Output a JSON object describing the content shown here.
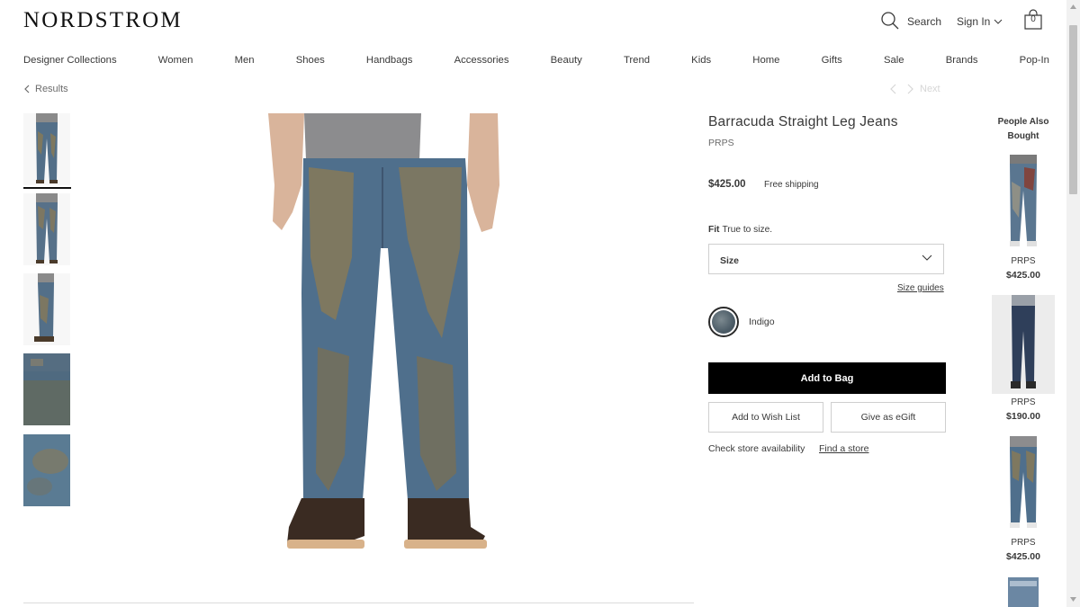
{
  "header": {
    "logo": "NORDSTROM",
    "search_label": "Search",
    "sign_in_label": "Sign In",
    "bag_count": "0"
  },
  "nav": {
    "items": [
      "Designer Collections",
      "Women",
      "Men",
      "Shoes",
      "Handbags",
      "Accessories",
      "Beauty",
      "Trend",
      "Kids",
      "Home",
      "Gifts",
      "Sale",
      "Brands",
      "Pop-In"
    ]
  },
  "breadcrumb": {
    "results_label": "Results",
    "next_label": "Next"
  },
  "product": {
    "title": "Barracuda Straight Leg Jeans",
    "brand": "PRPS",
    "price": "$425.00",
    "shipping": "Free shipping",
    "fit_label": "Fit",
    "fit_value": "True to size.",
    "size_label": "Size",
    "size_guides_label": "Size guides",
    "color_label": "Indigo",
    "add_to_bag_label": "Add to Bag",
    "wish_list_label": "Add to Wish List",
    "egift_label": "Give as eGift",
    "store_availability_label": "Check store availability",
    "find_store_label": "Find a store"
  },
  "people_also_bought": {
    "title": "People Also Bought",
    "items": [
      {
        "brand": "PRPS",
        "price": "$425.00"
      },
      {
        "brand": "PRPS",
        "price": "$190.00"
      },
      {
        "brand": "PRPS",
        "price": "$425.00"
      }
    ]
  },
  "colors": {
    "denim": "#4f6f8c",
    "mud": "#8a7a55",
    "button_black": "#000000"
  }
}
